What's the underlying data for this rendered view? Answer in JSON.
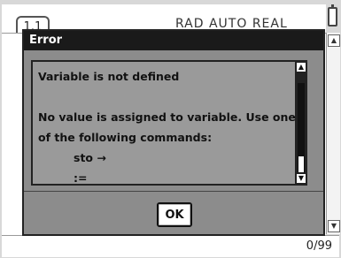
{
  "header": {
    "tab_label": "1.1",
    "mode_status": "RAD AUTO REAL"
  },
  "status_bar": {
    "entry_count": "0/99"
  },
  "dialog": {
    "title": "Error",
    "message_title": "Variable is not defined",
    "message_line_1": "No value is assigned to variable. Use one",
    "message_line_2": "of the following commands:",
    "command_1": "sto →",
    "command_2": ":=",
    "ok_label": "OK"
  }
}
